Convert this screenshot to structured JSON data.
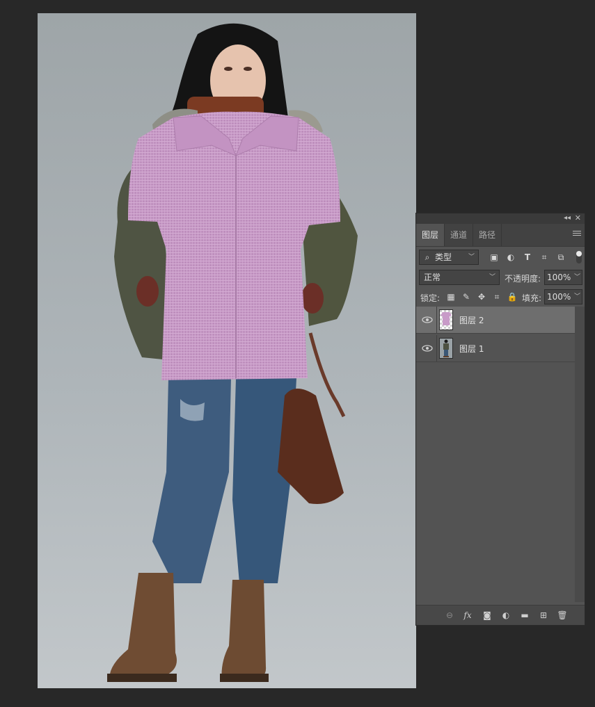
{
  "panel": {
    "collapse_icon": "collapse-icon",
    "close_icon": "close-icon",
    "tabs": [
      {
        "label": "图层",
        "active": true
      },
      {
        "label": "通道",
        "active": false
      },
      {
        "label": "路径",
        "active": false
      }
    ],
    "filter": {
      "value": "类型",
      "icons": [
        "image-filter-icon",
        "adjustment-filter-icon",
        "type-filter-icon",
        "shape-filter-icon",
        "smart-object-filter-icon"
      ]
    },
    "blend_mode": "正常",
    "opacity_label": "不透明度:",
    "opacity_value": "100%",
    "lock_label": "锁定:",
    "lock_icons": [
      "lock-transparent-icon",
      "lock-image-icon",
      "lock-position-icon",
      "lock-artboard-icon",
      "lock-all-icon"
    ],
    "fill_label": "填充:",
    "fill_value": "100%",
    "layers": [
      {
        "name": "图层 2",
        "visible": true,
        "selected": true,
        "thumb": "pink-shirt-thumbnail"
      },
      {
        "name": "图层 1",
        "visible": true,
        "selected": false,
        "thumb": "person-photo-thumbnail"
      }
    ],
    "bottom_icons": [
      "link-layers-icon",
      "fx-icon",
      "add-mask-icon",
      "new-adjustment-icon",
      "new-group-icon",
      "new-layer-icon",
      "delete-layer-icon"
    ],
    "fx_label": "fx"
  },
  "colors": {
    "panel_bg": "#535353",
    "selected_layer": "#6e6e6e",
    "shirt": "#c89bc8"
  }
}
